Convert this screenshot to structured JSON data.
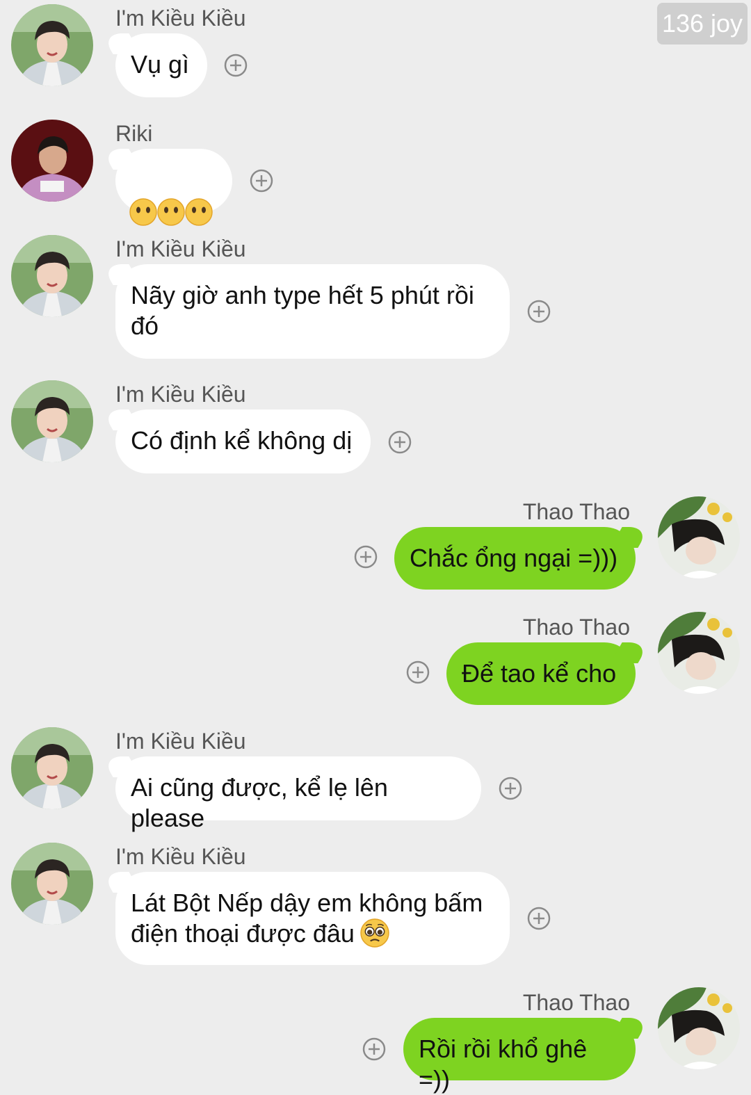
{
  "header": {
    "badge": "136 joy"
  },
  "messages": [
    {
      "sender": "I'm Kiều Kiều",
      "text": "Vụ gì"
    },
    {
      "sender": "Riki",
      "text": ""
    },
    {
      "sender": "I'm Kiều Kiều",
      "text": "Nãy giờ anh type hết 5 phút rồi\nđó"
    },
    {
      "sender": "I'm Kiều Kiều",
      "text": "Có định kể không dị"
    },
    {
      "sender": "Thao Thao",
      "text": "Chắc ổng ngại =)))"
    },
    {
      "sender": "Thao Thao",
      "text": "Để tao kể cho"
    },
    {
      "sender": "I'm Kiều Kiều",
      "text": "Ai cũng được, kể lẹ lên please"
    },
    {
      "sender": "I'm Kiều Kiều",
      "text": "Lát Bột Nếp dậy em không bấm\nđiện thoại được đâu"
    },
    {
      "sender": "Thao Thao",
      "text": "Rồi rồi khổ ghê =))"
    }
  ],
  "icons": {
    "add_reaction": "plus-circle-icon",
    "neutral_face": "neutral-face-emoji",
    "pleading_face": "pleading-face-emoji"
  },
  "colors": {
    "background": "#ededed",
    "incoming_bubble": "#ffffff",
    "outgoing_bubble": "#7ed321"
  }
}
